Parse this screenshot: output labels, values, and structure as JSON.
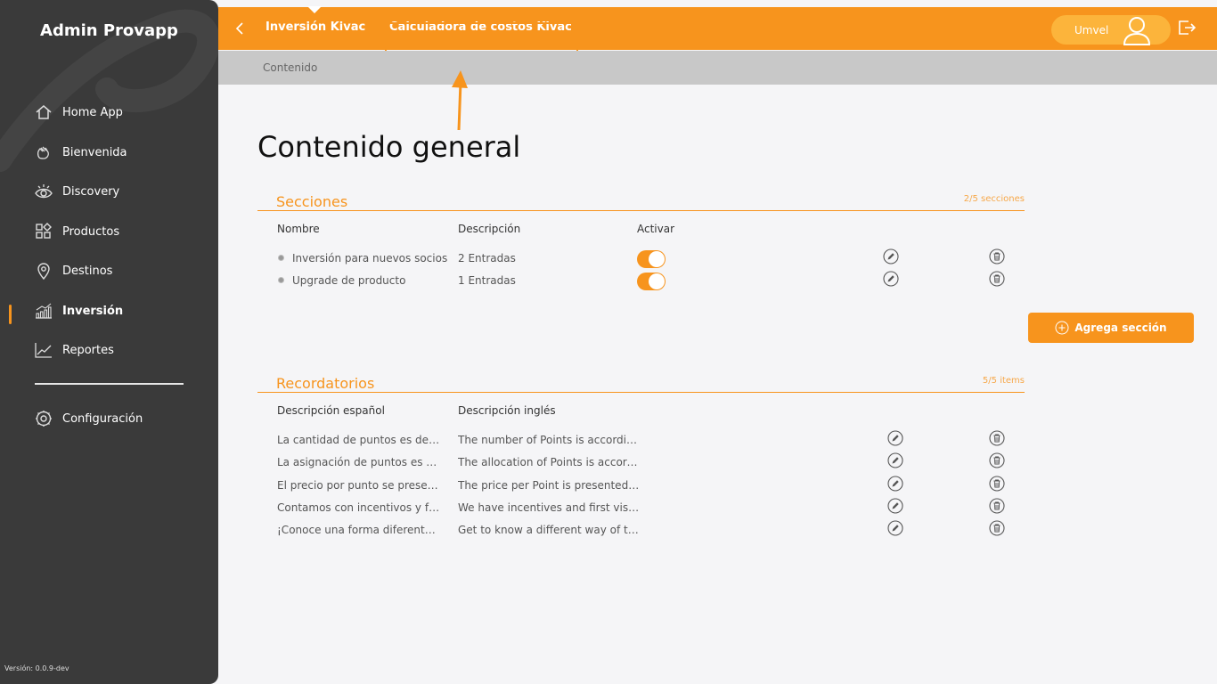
{
  "sidebar": {
    "title": "Admin Provapp",
    "items": [
      {
        "label": "Home App",
        "icon": "home-icon"
      },
      {
        "label": "Bienvenida",
        "icon": "wave-hand-icon"
      },
      {
        "label": "Discovery",
        "icon": "eye-icon"
      },
      {
        "label": "Productos",
        "icon": "grid-icon"
      },
      {
        "label": "Destinos",
        "icon": "location-pin-icon"
      },
      {
        "label": "Inversión",
        "icon": "bar-chart-icon",
        "active": true
      },
      {
        "label": "Reportes",
        "icon": "line-chart-icon"
      }
    ],
    "settings": {
      "label": "Configuración",
      "icon": "gear-icon"
    },
    "version": "Versión: 0.0.9-dev"
  },
  "topbar": {
    "tab1": "Inversión Kivac",
    "tab2": "Calculadora de costos Kivac",
    "user": "Umvel"
  },
  "breadcrumb": "Contenido",
  "page_title": "Contenido general",
  "secciones": {
    "title": "Secciones",
    "count": "2/5 secciones",
    "headers": {
      "name": "Nombre",
      "desc": "Descripción",
      "active": "Activar"
    },
    "rows": [
      {
        "name": "Inversión para nuevos socios",
        "desc": "2 Entradas"
      },
      {
        "name": "Upgrade de producto",
        "desc": "1 Entradas"
      }
    ],
    "add_label": "Agrega sección"
  },
  "recordatorios": {
    "title": "Recordatorios",
    "count": "5/5 items",
    "headers": {
      "es": "Descripción español",
      "en": "Descripción inglés"
    },
    "rows": [
      {
        "es": "La cantidad de puntos es de ...",
        "en": "The number of Points is accordin..."
      },
      {
        "es": "La asignación de puntos es d...",
        "en": "The allocation of Points is accord..."
      },
      {
        "es": "El precio por punto se presen...",
        "en": "The price per Point is presented i..."
      },
      {
        "es": "Contamos con incentivos y fa...",
        "en": "We have incentives and first visit ..."
      },
      {
        "es": "¡Conoce una forma diferente ...",
        "en": "Get to know a different way of tra..."
      }
    ]
  },
  "colors": {
    "accent": "#f7941d",
    "sidebar": "#3a3a3a"
  }
}
